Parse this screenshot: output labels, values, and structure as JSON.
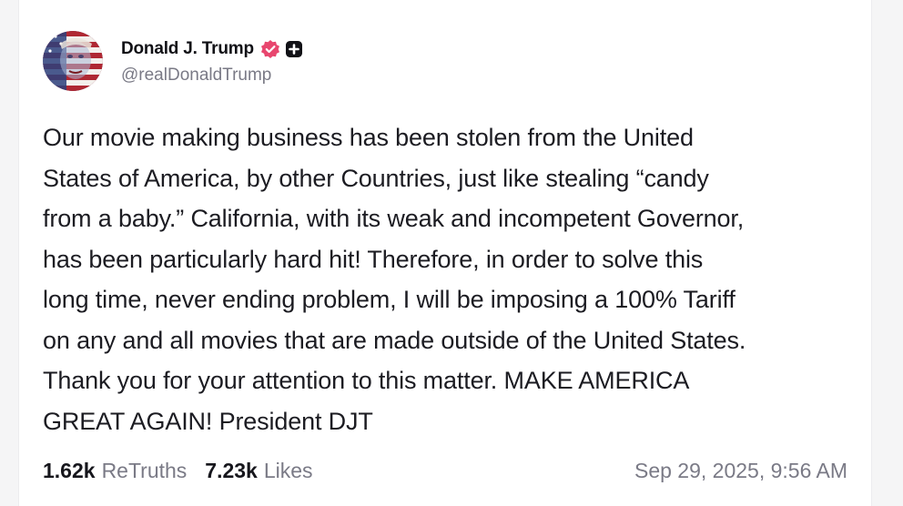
{
  "post": {
    "author": {
      "display_name": "Donald J. Trump",
      "handle": "@realDonaldTrump",
      "verified_icon": "verified-badge-icon",
      "extra_badge_icon": "plus-badge-icon"
    },
    "text": "Our movie making business has been stolen from the United\nStates of America, by other Countries, just like stealing “candy\nfrom a baby.” California, with its weak and incompetent Governor,\nhas been particularly hard hit! Therefore, in order to solve this\nlong time, never ending problem, I will be imposing a 100% Tariff\non any and all movies that are made outside of the United States.\nThank you for your attention to this matter. MAKE AMERICA\nGREAT AGAIN! President DJT",
    "stats": {
      "retruths_count": "1.62k",
      "retruths_label": "ReTruths",
      "likes_count": "7.23k",
      "likes_label": "Likes"
    },
    "timestamp": "Sep 29, 2025, 9:56 AM"
  },
  "colors": {
    "verified_badge": "#e8466e",
    "text_primary": "#1c1c22",
    "text_secondary": "#7a7a86"
  }
}
